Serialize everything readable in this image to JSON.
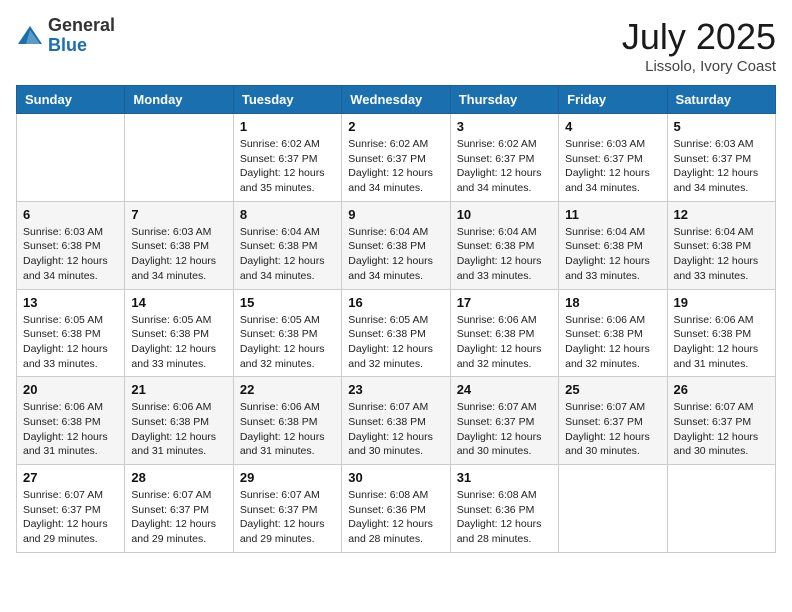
{
  "header": {
    "logo_general": "General",
    "logo_blue": "Blue",
    "month_year": "July 2025",
    "location": "Lissolo, Ivory Coast"
  },
  "days_of_week": [
    "Sunday",
    "Monday",
    "Tuesday",
    "Wednesday",
    "Thursday",
    "Friday",
    "Saturday"
  ],
  "weeks": [
    [
      {
        "day": "",
        "info": ""
      },
      {
        "day": "",
        "info": ""
      },
      {
        "day": "1",
        "info": "Sunrise: 6:02 AM\nSunset: 6:37 PM\nDaylight: 12 hours\nand 35 minutes."
      },
      {
        "day": "2",
        "info": "Sunrise: 6:02 AM\nSunset: 6:37 PM\nDaylight: 12 hours\nand 34 minutes."
      },
      {
        "day": "3",
        "info": "Sunrise: 6:02 AM\nSunset: 6:37 PM\nDaylight: 12 hours\nand 34 minutes."
      },
      {
        "day": "4",
        "info": "Sunrise: 6:03 AM\nSunset: 6:37 PM\nDaylight: 12 hours\nand 34 minutes."
      },
      {
        "day": "5",
        "info": "Sunrise: 6:03 AM\nSunset: 6:37 PM\nDaylight: 12 hours\nand 34 minutes."
      }
    ],
    [
      {
        "day": "6",
        "info": "Sunrise: 6:03 AM\nSunset: 6:38 PM\nDaylight: 12 hours\nand 34 minutes."
      },
      {
        "day": "7",
        "info": "Sunrise: 6:03 AM\nSunset: 6:38 PM\nDaylight: 12 hours\nand 34 minutes."
      },
      {
        "day": "8",
        "info": "Sunrise: 6:04 AM\nSunset: 6:38 PM\nDaylight: 12 hours\nand 34 minutes."
      },
      {
        "day": "9",
        "info": "Sunrise: 6:04 AM\nSunset: 6:38 PM\nDaylight: 12 hours\nand 34 minutes."
      },
      {
        "day": "10",
        "info": "Sunrise: 6:04 AM\nSunset: 6:38 PM\nDaylight: 12 hours\nand 33 minutes."
      },
      {
        "day": "11",
        "info": "Sunrise: 6:04 AM\nSunset: 6:38 PM\nDaylight: 12 hours\nand 33 minutes."
      },
      {
        "day": "12",
        "info": "Sunrise: 6:04 AM\nSunset: 6:38 PM\nDaylight: 12 hours\nand 33 minutes."
      }
    ],
    [
      {
        "day": "13",
        "info": "Sunrise: 6:05 AM\nSunset: 6:38 PM\nDaylight: 12 hours\nand 33 minutes."
      },
      {
        "day": "14",
        "info": "Sunrise: 6:05 AM\nSunset: 6:38 PM\nDaylight: 12 hours\nand 33 minutes."
      },
      {
        "day": "15",
        "info": "Sunrise: 6:05 AM\nSunset: 6:38 PM\nDaylight: 12 hours\nand 32 minutes."
      },
      {
        "day": "16",
        "info": "Sunrise: 6:05 AM\nSunset: 6:38 PM\nDaylight: 12 hours\nand 32 minutes."
      },
      {
        "day": "17",
        "info": "Sunrise: 6:06 AM\nSunset: 6:38 PM\nDaylight: 12 hours\nand 32 minutes."
      },
      {
        "day": "18",
        "info": "Sunrise: 6:06 AM\nSunset: 6:38 PM\nDaylight: 12 hours\nand 32 minutes."
      },
      {
        "day": "19",
        "info": "Sunrise: 6:06 AM\nSunset: 6:38 PM\nDaylight: 12 hours\nand 31 minutes."
      }
    ],
    [
      {
        "day": "20",
        "info": "Sunrise: 6:06 AM\nSunset: 6:38 PM\nDaylight: 12 hours\nand 31 minutes."
      },
      {
        "day": "21",
        "info": "Sunrise: 6:06 AM\nSunset: 6:38 PM\nDaylight: 12 hours\nand 31 minutes."
      },
      {
        "day": "22",
        "info": "Sunrise: 6:06 AM\nSunset: 6:38 PM\nDaylight: 12 hours\nand 31 minutes."
      },
      {
        "day": "23",
        "info": "Sunrise: 6:07 AM\nSunset: 6:38 PM\nDaylight: 12 hours\nand 30 minutes."
      },
      {
        "day": "24",
        "info": "Sunrise: 6:07 AM\nSunset: 6:37 PM\nDaylight: 12 hours\nand 30 minutes."
      },
      {
        "day": "25",
        "info": "Sunrise: 6:07 AM\nSunset: 6:37 PM\nDaylight: 12 hours\nand 30 minutes."
      },
      {
        "day": "26",
        "info": "Sunrise: 6:07 AM\nSunset: 6:37 PM\nDaylight: 12 hours\nand 30 minutes."
      }
    ],
    [
      {
        "day": "27",
        "info": "Sunrise: 6:07 AM\nSunset: 6:37 PM\nDaylight: 12 hours\nand 29 minutes."
      },
      {
        "day": "28",
        "info": "Sunrise: 6:07 AM\nSunset: 6:37 PM\nDaylight: 12 hours\nand 29 minutes."
      },
      {
        "day": "29",
        "info": "Sunrise: 6:07 AM\nSunset: 6:37 PM\nDaylight: 12 hours\nand 29 minutes."
      },
      {
        "day": "30",
        "info": "Sunrise: 6:08 AM\nSunset: 6:36 PM\nDaylight: 12 hours\nand 28 minutes."
      },
      {
        "day": "31",
        "info": "Sunrise: 6:08 AM\nSunset: 6:36 PM\nDaylight: 12 hours\nand 28 minutes."
      },
      {
        "day": "",
        "info": ""
      },
      {
        "day": "",
        "info": ""
      }
    ]
  ]
}
